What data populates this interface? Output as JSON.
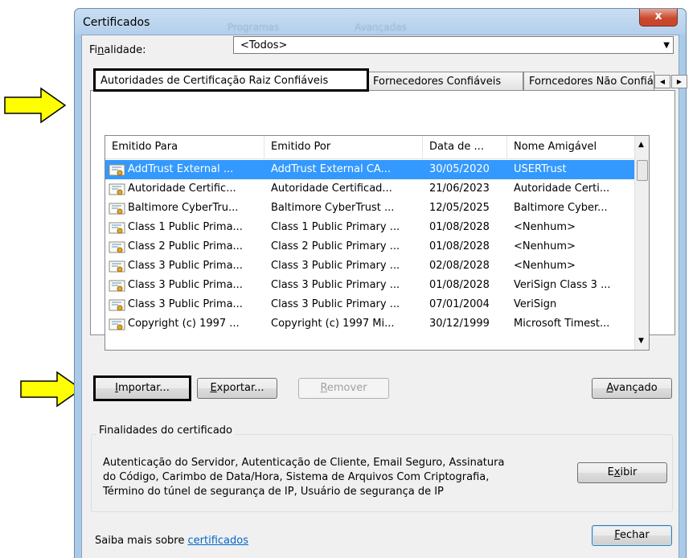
{
  "window": {
    "title": "Certificados",
    "close_glyph": "x",
    "background_menu_ghosts": [
      "Programas",
      "Avançadas"
    ]
  },
  "purpose": {
    "label_prefix": "Fi",
    "label_mnemonic": "n",
    "label_suffix": "alidade:",
    "value": "<Todos>"
  },
  "tabs": [
    {
      "label": "Autoridades de Certificação Raiz Confiáveis",
      "active": true
    },
    {
      "label": "Fornecedores Confiáveis",
      "active": false
    },
    {
      "label": "Forncedores Não Confiáveis",
      "active": false
    }
  ],
  "list": {
    "columns": [
      "Emitido Para",
      "Emitido Por",
      "Data de ...",
      "Nome Amigável"
    ],
    "rows": [
      [
        "AddTrust External ...",
        "AddTrust External CA...",
        "30/05/2020",
        "USERTrust"
      ],
      [
        "Autoridade Certific...",
        "Autoridade Certificad...",
        "21/06/2023",
        "Autoridade Certi..."
      ],
      [
        "Baltimore CyberTru...",
        "Baltimore CyberTrust ...",
        "12/05/2025",
        "Baltimore Cyber..."
      ],
      [
        "Class 1 Public Prima...",
        "Class 1 Public Primary ...",
        "01/08/2028",
        "<Nenhum>"
      ],
      [
        "Class 2 Public Prima...",
        "Class 2 Public Primary ...",
        "01/08/2028",
        "<Nenhum>"
      ],
      [
        "Class 3 Public Prima...",
        "Class 3 Public Primary ...",
        "02/08/2028",
        "<Nenhum>"
      ],
      [
        "Class 3 Public Prima...",
        "Class 3 Public Primary ...",
        "01/08/2028",
        "VeriSign Class 3 ..."
      ],
      [
        "Class 3 Public Prima...",
        "Class 3 Public Primary ...",
        "07/01/2004",
        "VeriSign"
      ],
      [
        "Copyright (c) 1997 ...",
        "Copyright (c) 1997 Mi...",
        "30/12/1999",
        "Microsoft Timest..."
      ]
    ],
    "selected_row_index": 0
  },
  "buttons": {
    "import": {
      "mnemonic": "I",
      "rest": "mportar..."
    },
    "export": {
      "mnemonic": "E",
      "rest": "xportar..."
    },
    "remove": {
      "mnemonic": "R",
      "rest": "emover"
    },
    "advanced": {
      "mnemonic": "A",
      "rest": "vançado"
    },
    "view": {
      "pre": "E",
      "mnemonic": "x",
      "rest": "ibir"
    },
    "close": {
      "mnemonic": "F",
      "rest": "echar"
    }
  },
  "purposes_group": {
    "title": "Finalidades do certificado",
    "description_lines": [
      "Autenticação do Servidor, Autenticação de Cliente, Email Seguro, Assinatura",
      "do Código, Carimbo de Data/Hora, Sistema de Arquivos Com Criptografia,",
      "Término do túnel de segurança de IP, Usuário de segurança de IP"
    ]
  },
  "footer": {
    "learn_more_text": "Saiba mais sobre ",
    "learn_more_link": "certificados"
  },
  "colors": {
    "selection": "#3399ff",
    "arrow_fill": "#ffff00",
    "link": "#0066cc"
  }
}
